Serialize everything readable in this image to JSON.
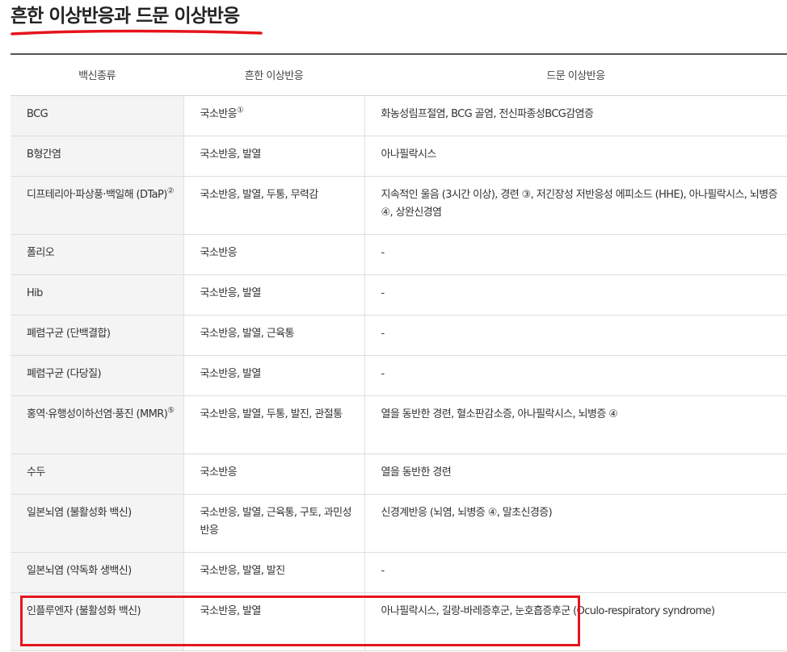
{
  "page": {
    "title": "흔한 이상반응과 드문 이상반응",
    "accent_color": "#e6141c"
  },
  "table": {
    "headers": [
      "백신종류",
      "흔한 이상반응",
      "드문 이상반응"
    ],
    "rows": [
      {
        "vaccine": "BCG",
        "vaccine_sup": "",
        "common": "국소반응",
        "common_sup": "①",
        "rare": "화농성림프절염, BCG 골염, 전신파종성BCG감염증"
      },
      {
        "vaccine": "B형간염",
        "vaccine_sup": "",
        "common": "국소반응, 발열",
        "common_sup": "",
        "rare": "아나필락시스"
      },
      {
        "vaccine": "디프테리아·파상풍·백일해 (DTaP)",
        "vaccine_sup": "②",
        "common": "국소반응, 발열, 두통, 무력감",
        "common_sup": "",
        "rare": "지속적인 울음 (3시간 이상), 경련 ③, 저긴장성 저반응성 에피소드 (HHE), 아나필락시스, 뇌병증 ④, 상완신경염"
      },
      {
        "vaccine": "폴리오",
        "vaccine_sup": "",
        "common": "국소반응",
        "common_sup": "",
        "rare": "-"
      },
      {
        "vaccine": "Hib",
        "vaccine_sup": "",
        "common": "국소반응, 발열",
        "common_sup": "",
        "rare": "-"
      },
      {
        "vaccine": "폐렴구균 (단백결합)",
        "vaccine_sup": "",
        "common": "국소반응, 발열, 근육통",
        "common_sup": "",
        "rare": "-"
      },
      {
        "vaccine": "폐렴구균 (다당질)",
        "vaccine_sup": "",
        "common": "국소반응, 발열",
        "common_sup": "",
        "rare": "-"
      },
      {
        "vaccine": "홍역·유행성이하선염·풍진 (MMR)",
        "vaccine_sup": "⑤",
        "common": "국소반응, 발열, 두통, 발진, 관절통",
        "common_sup": "",
        "rare": "열을 동반한 경련, 혈소판감소증, 아나필락시스, 뇌병증 ④"
      },
      {
        "vaccine": "수두",
        "vaccine_sup": "",
        "common": "국소반응",
        "common_sup": "",
        "rare": "열을 동반한 경련"
      },
      {
        "vaccine": "일본뇌염 (불활성화 백신)",
        "vaccine_sup": "",
        "common": "국소반응, 발열, 근육통, 구토, 과민성 반응",
        "common_sup": "",
        "rare": "신경계반응 (뇌염, 뇌병증 ④, 말초신경증)"
      },
      {
        "vaccine": "일본뇌염 (약독화 생백신)",
        "vaccine_sup": "",
        "common": "국소반응, 발열, 발진",
        "common_sup": "",
        "rare": "-"
      },
      {
        "vaccine": "인플루엔자 (불활성화 백신)",
        "vaccine_sup": "",
        "common": "국소반응, 발열",
        "common_sup": "",
        "rare": "아나필락시스, 길랑-바레증후군, 눈호흡증후군 (Oculo-respiratory syndrome)"
      }
    ]
  }
}
